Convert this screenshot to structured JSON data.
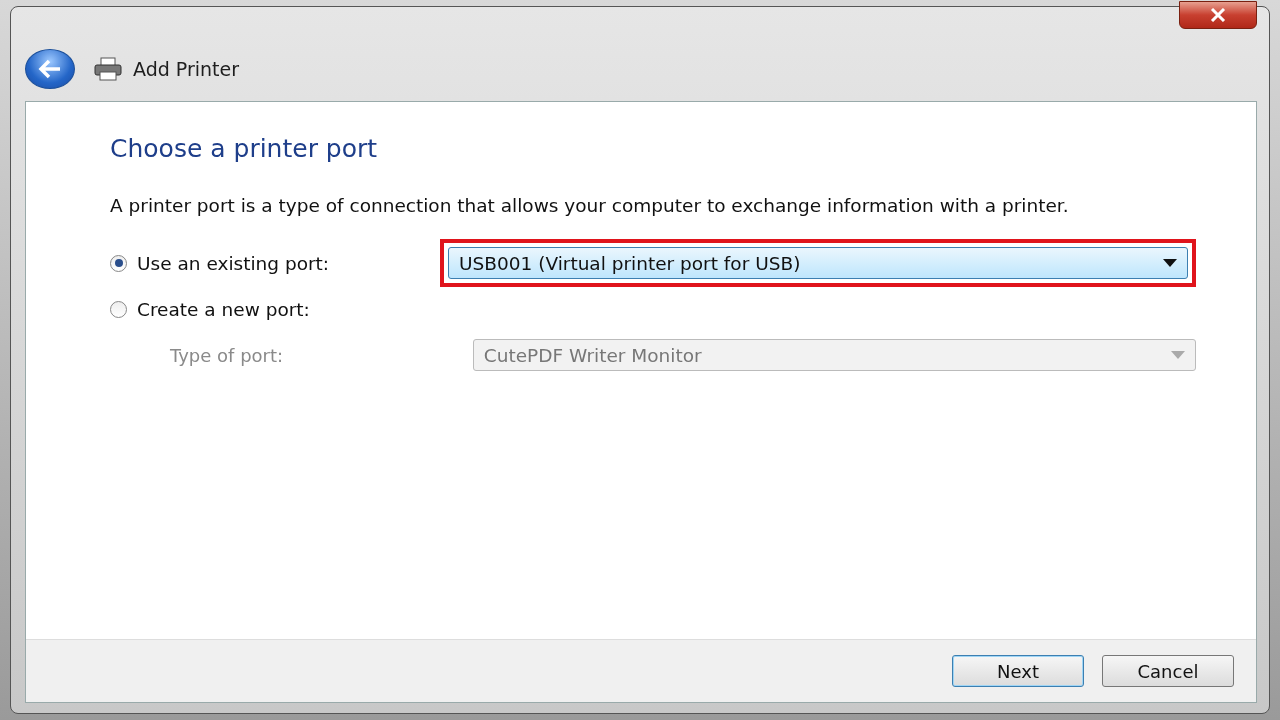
{
  "window": {
    "title": "Add Printer"
  },
  "heading": "Choose a printer port",
  "description": "A printer port is a type of connection that allows your computer to exchange information with a printer.",
  "options": [
    {
      "label": "Use an existing port:",
      "selected": true,
      "dropdown": {
        "value": "USB001 (Virtual printer port for USB)",
        "highlighted": true
      }
    },
    {
      "label": "Create a new port:",
      "selected": false
    }
  ],
  "port_type": {
    "label": "Type of port:",
    "value": "CutePDF Writer Monitor",
    "disabled": true
  },
  "buttons": [
    {
      "label": "Next",
      "default": true
    },
    {
      "label": "Cancel",
      "default": false
    }
  ]
}
